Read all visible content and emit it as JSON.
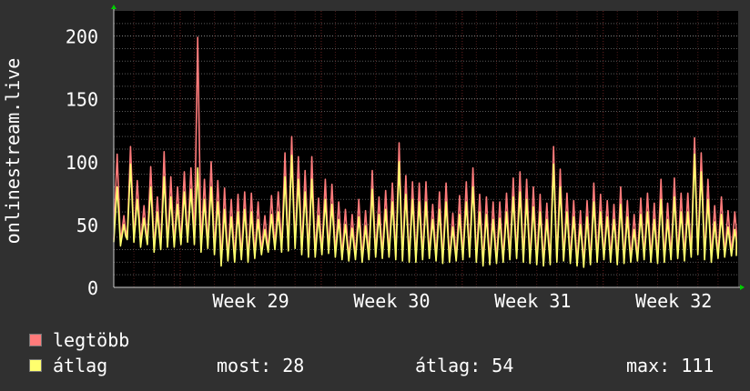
{
  "chart_data": {
    "type": "line",
    "ylabel": "onlinestream.live",
    "ylim": [
      0,
      220
    ],
    "yticks": [
      0,
      50,
      100,
      150,
      200
    ],
    "xtick_labels": [
      "Week 29",
      "Week 30",
      "Week 31",
      "Week 32"
    ],
    "x_days": 31,
    "colors": {
      "max": "#ff7b7b",
      "avg": "#ffff6e",
      "background": "#000000",
      "grid": "#5a5a5a",
      "vgrid": "#6a2020",
      "axis_arrow": "#00cc00"
    },
    "series": [
      {
        "name": "legtöbb",
        "values": [
          106,
          57,
          112,
          85,
          65,
          96,
          72,
          108,
          88,
          80,
          92,
          95,
          199,
          86,
          100,
          85,
          79,
          70,
          74,
          76,
          75,
          68,
          57,
          73,
          76,
          107,
          120,
          104,
          93,
          104,
          71,
          86,
          82,
          68,
          62,
          58,
          70,
          61,
          93,
          72,
          77,
          83,
          115,
          89,
          84,
          83,
          84,
          66,
          76,
          83,
          59,
          73,
          84,
          95,
          74,
          72,
          68,
          68,
          75,
          87,
          92,
          86,
          80,
          74,
          67,
          112,
          94,
          75,
          69,
          61,
          69,
          83,
          74,
          69,
          66,
          80,
          69,
          58,
          71,
          75,
          67,
          86,
          67,
          87,
          75,
          75,
          119,
          107,
          86,
          65,
          72,
          61,
          60
        ],
        "min": [
          38,
          35,
          40,
          38,
          34,
          36,
          30,
          32,
          34,
          34,
          36,
          38,
          36,
          30,
          33,
          28,
          19,
          23,
          22,
          24,
          22,
          25,
          28,
          30,
          32,
          30,
          31,
          33,
          28,
          26,
          26,
          28,
          29,
          26,
          24,
          23,
          24,
          22,
          24,
          26,
          25,
          26,
          24,
          23,
          22,
          22,
          24,
          25,
          23,
          21,
          22,
          23,
          24,
          26,
          22,
          19,
          20,
          21,
          22,
          24,
          25,
          22,
          21,
          20,
          19,
          20,
          22,
          23,
          21,
          19,
          18,
          20,
          22,
          24,
          22,
          20,
          21,
          22,
          23,
          24,
          22,
          21,
          22,
          24,
          25,
          23,
          26,
          28,
          24,
          22,
          25,
          26,
          27
        ]
      },
      {
        "name": "átlag",
        "values": [
          80,
          50,
          98,
          70,
          55,
          80,
          60,
          88,
          72,
          66,
          76,
          78,
          95,
          70,
          80,
          68,
          62,
          56,
          60,
          62,
          60,
          54,
          46,
          58,
          60,
          88,
          105,
          86,
          76,
          86,
          57,
          70,
          66,
          54,
          50,
          47,
          56,
          49,
          78,
          58,
          62,
          68,
          100,
          74,
          70,
          68,
          68,
          54,
          62,
          68,
          48,
          58,
          68,
          80,
          60,
          58,
          54,
          55,
          60,
          72,
          76,
          70,
          64,
          60,
          54,
          98,
          80,
          60,
          56,
          50,
          56,
          68,
          60,
          56,
          54,
          66,
          56,
          46,
          58,
          60,
          54,
          70,
          54,
          72,
          60,
          60,
          106,
          92,
          70,
          52,
          58,
          48,
          46
        ],
        "min": [
          36,
          33,
          38,
          36,
          32,
          34,
          28,
          30,
          32,
          32,
          34,
          36,
          34,
          28,
          31,
          26,
          17,
          21,
          20,
          22,
          20,
          23,
          26,
          28,
          30,
          28,
          29,
          31,
          26,
          24,
          24,
          26,
          27,
          24,
          22,
          21,
          22,
          20,
          22,
          24,
          23,
          24,
          22,
          21,
          20,
          20,
          22,
          23,
          21,
          19,
          20,
          21,
          22,
          24,
          20,
          17,
          18,
          19,
          20,
          22,
          23,
          20,
          19,
          18,
          17,
          18,
          20,
          21,
          19,
          17,
          16,
          18,
          20,
          22,
          20,
          18,
          19,
          20,
          21,
          22,
          20,
          19,
          20,
          22,
          23,
          21,
          24,
          26,
          22,
          20,
          23,
          24,
          25
        ]
      }
    ]
  },
  "legend": {
    "max_label": "legtöbb",
    "avg_label": "átlag",
    "max_color": "#ff7b7b",
    "avg_color": "#ffff6e"
  },
  "stats": {
    "now": "most: 28",
    "avg": "átlag: 54",
    "max": "max: 111"
  }
}
